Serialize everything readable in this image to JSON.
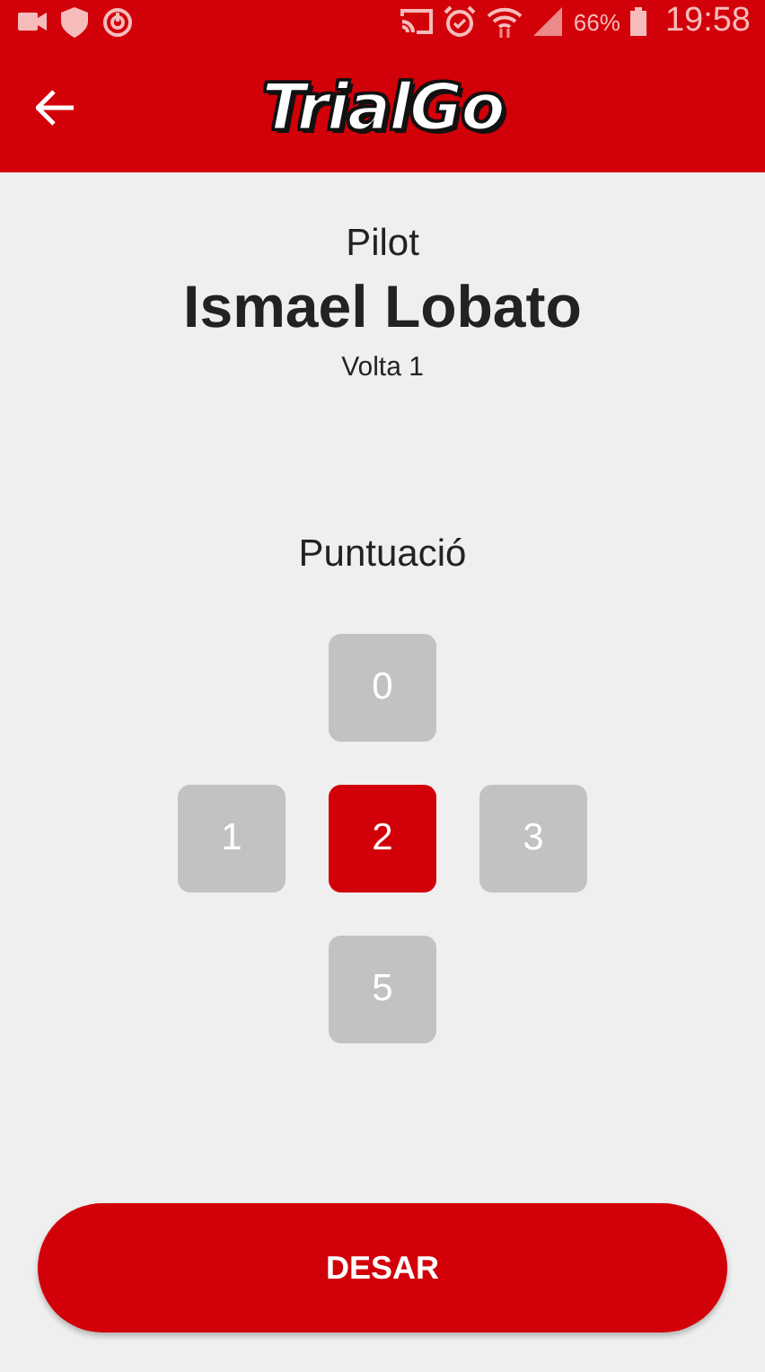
{
  "status_bar": {
    "battery": "66%",
    "time": "19:58"
  },
  "app_bar": {
    "title": "TrialGo"
  },
  "pilot": {
    "label": "Pilot",
    "name": "Ismael Lobato",
    "lap": "Volta 1"
  },
  "score": {
    "label": "Puntuació",
    "rows": [
      [
        {
          "value": "0",
          "selected": false
        }
      ],
      [
        {
          "value": "1",
          "selected": false
        },
        {
          "value": "2",
          "selected": true
        },
        {
          "value": "3",
          "selected": false
        }
      ],
      [
        {
          "value": "5",
          "selected": false
        }
      ]
    ]
  },
  "save_button": "DESAR"
}
